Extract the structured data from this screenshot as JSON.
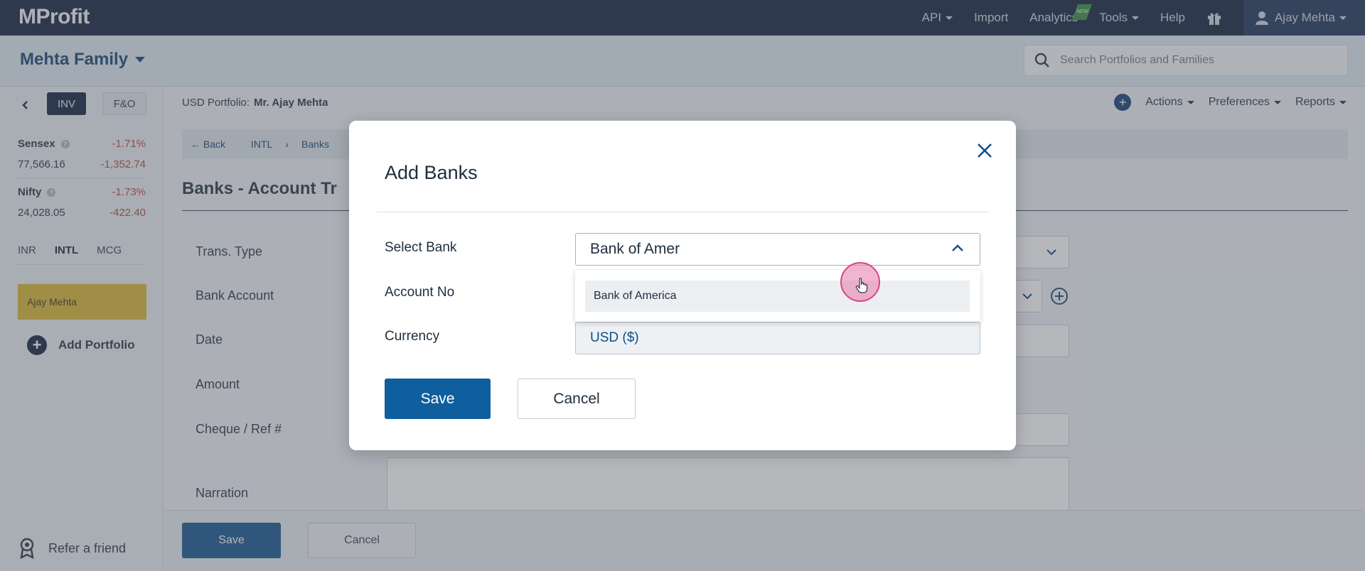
{
  "topnav": {
    "logo": "MProfit",
    "items": [
      {
        "label": "API",
        "dropdown": true
      },
      {
        "label": "Import",
        "dropdown": false
      },
      {
        "label": "Analytics",
        "dropdown": false,
        "badge": "NEW"
      },
      {
        "label": "Tools",
        "dropdown": true
      },
      {
        "label": "Help",
        "dropdown": false
      }
    ],
    "gift_icon": "gift-icon",
    "user_name": "Ajay Mehta"
  },
  "subheader": {
    "family_name": "Mehta Family",
    "search_placeholder": "Search Portfolios and Families"
  },
  "sidebar": {
    "segments": [
      "INV",
      "F&O"
    ],
    "active_segment": "INV",
    "indices": [
      {
        "name": "Sensex",
        "change_pct": "-1.71%",
        "value": "77,566.16",
        "change": "-1,352.74"
      },
      {
        "name": "Nifty",
        "change_pct": "-1.73%",
        "value": "24,028.05",
        "change": "-422.40"
      }
    ],
    "market_tabs": [
      "INR",
      "INTL",
      "MCG"
    ],
    "active_market_tab": "INTL",
    "person": "Ajay Mehta",
    "add_portfolio": "Add Portfolio",
    "refer": "Refer a friend"
  },
  "main": {
    "portfolio_label": "USD Portfolio:",
    "portfolio_name": "Mr. Ajay Mehta",
    "actions": [
      "Actions",
      "Preferences",
      "Reports"
    ],
    "breadcrumb": [
      "Back",
      "INTL",
      "Banks"
    ],
    "page_title": "Banks - Account Tr",
    "form_labels": [
      "Trans. Type",
      "Bank Account",
      "Date",
      "Amount",
      "Cheque / Ref #",
      "Narration"
    ],
    "footer_save": "Save",
    "footer_cancel": "Cancel"
  },
  "modal": {
    "title": "Add Banks",
    "labels": {
      "select_bank": "Select Bank",
      "account_no": "Account No",
      "currency": "Currency"
    },
    "select_bank_value": "Bank of Amer",
    "dropdown_options": [
      "Bank of America"
    ],
    "currency_value": "USD ($)",
    "save_label": "Save",
    "cancel_label": "Cancel"
  },
  "colors": {
    "nav_bg": "#0b1a3a",
    "primary": "#0f5f9e",
    "highlight_person": "#d9b52b",
    "negative": "#b3403a"
  }
}
